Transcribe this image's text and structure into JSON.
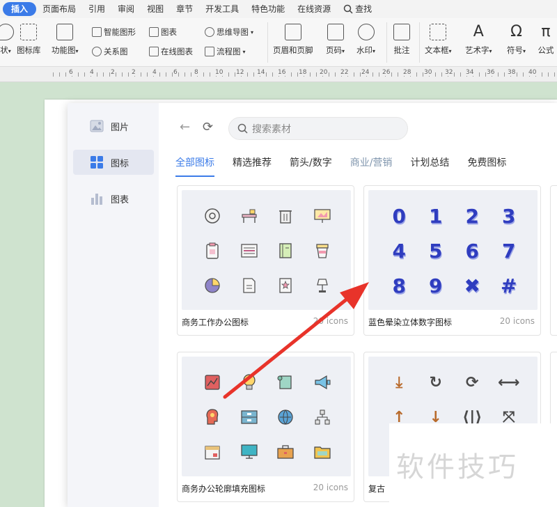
{
  "menu": {
    "items": [
      "插入",
      "页面布局",
      "引用",
      "审阅",
      "视图",
      "章节",
      "开发工具",
      "特色功能",
      "在线资源"
    ],
    "active_index": 0,
    "search_label": "查找"
  },
  "ribbon": {
    "shape_label": "状",
    "icon_lib_label": "图标库",
    "func_chart_label": "功能图",
    "smart_art_label": "智能图形",
    "chart_label": "图表",
    "mind_map_label": "思维导图",
    "relation_label": "关系图",
    "online_chart_label": "在线图表",
    "flowchart_label": "流程图",
    "header_footer_label": "页眉和页脚",
    "page_num_label": "页码",
    "watermark_label": "水印",
    "comment_label": "批注",
    "textbox_label": "文本框",
    "wordart_label": "艺术字",
    "symbol_label": "符号",
    "formula_label": "公式"
  },
  "ruler": {
    "numbers": [
      "6",
      "4",
      "2",
      "2",
      "4",
      "6",
      "8",
      "10",
      "12",
      "14",
      "16",
      "18",
      "20",
      "22",
      "24",
      "26",
      "28",
      "30",
      "32",
      "34",
      "36",
      "38",
      "40"
    ]
  },
  "sidebar": {
    "items": [
      {
        "label": "图片",
        "active": false
      },
      {
        "label": "图标",
        "active": true
      },
      {
        "label": "图表",
        "active": false
      }
    ]
  },
  "search": {
    "placeholder": "搜索素材"
  },
  "tabs": [
    {
      "label": "全部图标",
      "state": "active"
    },
    {
      "label": "精选推荐",
      "state": "normal"
    },
    {
      "label": "箭头/数字",
      "state": "normal"
    },
    {
      "label": "商业/营销",
      "state": "muted"
    },
    {
      "label": "计划总结",
      "state": "normal"
    },
    {
      "label": "免费图标",
      "state": "normal"
    }
  ],
  "cards": [
    {
      "title": "商务工作办公图标",
      "count": "20 icons"
    },
    {
      "title": "蓝色晕染立体数字图标",
      "count": "20 icons",
      "digits": [
        "0",
        "1",
        "2",
        "3",
        "4",
        "5",
        "6",
        "7",
        "8",
        "9",
        "✖",
        "#"
      ]
    },
    {
      "title": "商务办公轮廓填充图标",
      "count": "20 icons"
    },
    {
      "title": "复古",
      "symbols": [
        "⤓",
        "↻",
        "⟳",
        "⟷",
        "↑",
        "↓",
        "⟨|⟩",
        "⤧"
      ]
    }
  ],
  "watermark": {
    "text": "软件技巧"
  },
  "colors": {
    "accent": "#3b7be8",
    "arrow": "#e8332a",
    "digit_blue": "#2f3dbf",
    "background": "#cfe3cf"
  }
}
